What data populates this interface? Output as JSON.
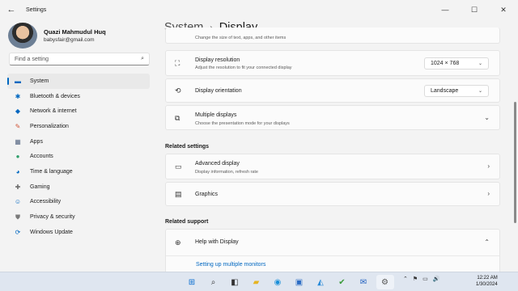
{
  "window": {
    "title": "Settings",
    "back_icon": "back-arrow-icon",
    "controls": {
      "minimize": "—",
      "maximize": "☐",
      "close": "✕"
    }
  },
  "profile": {
    "name": "Quazi Mahmudul Huq",
    "email": "babysfair@gmail.com"
  },
  "search": {
    "placeholder": "Find a setting",
    "icon": "search-icon"
  },
  "sidebar": {
    "items": [
      {
        "label": "System",
        "icon": "display-icon",
        "glyph": "▬",
        "color": "#0067c0",
        "active": true
      },
      {
        "label": "Bluetooth & devices",
        "icon": "bluetooth-icon",
        "glyph": "✱",
        "color": "#0067c0",
        "active": false
      },
      {
        "label": "Network & internet",
        "icon": "wifi-icon",
        "glyph": "◆",
        "color": "#0067c0",
        "active": false
      },
      {
        "label": "Personalization",
        "icon": "brush-icon",
        "glyph": "✎",
        "color": "#d0563a",
        "active": false
      },
      {
        "label": "Apps",
        "icon": "apps-icon",
        "glyph": "▦",
        "color": "#5a6a86",
        "active": false
      },
      {
        "label": "Accounts",
        "icon": "person-icon",
        "glyph": "●",
        "color": "#2e9e6a",
        "active": false
      },
      {
        "label": "Time & language",
        "icon": "globe-clock-icon",
        "glyph": "◕",
        "color": "#0067c0",
        "active": false
      },
      {
        "label": "Gaming",
        "icon": "gamepad-icon",
        "glyph": "✚",
        "color": "#6b6b6b",
        "active": false
      },
      {
        "label": "Accessibility",
        "icon": "accessibility-icon",
        "glyph": "☺",
        "color": "#0067c0",
        "active": false
      },
      {
        "label": "Privacy & security",
        "icon": "shield-icon",
        "glyph": "⛊",
        "color": "#7a7a7a",
        "active": false
      },
      {
        "label": "Windows Update",
        "icon": "update-icon",
        "glyph": "⟳",
        "color": "#0067c0",
        "active": false
      }
    ]
  },
  "breadcrumb": {
    "parent": "System",
    "separator": "›",
    "current": "Display"
  },
  "cards": {
    "partial_sub": "Change the size of text, apps, and other items",
    "resolution": {
      "title": "Display resolution",
      "sub": "Adjust the resolution to fit your connected display",
      "value": "1024 × 768",
      "icon": "resolution-icon"
    },
    "orientation": {
      "title": "Display orientation",
      "value": "Landscape",
      "icon": "orientation-icon"
    },
    "multiple": {
      "title": "Multiple displays",
      "sub": "Choose the presentation mode for your displays",
      "icon": "multiple-displays-icon"
    }
  },
  "related_settings": {
    "heading": "Related settings",
    "advanced": {
      "title": "Advanced display",
      "sub": "Display information, refresh rate",
      "icon": "monitor-icon"
    },
    "graphics": {
      "title": "Graphics",
      "icon": "graphics-icon"
    }
  },
  "related_support": {
    "heading": "Related support",
    "help": {
      "title": "Help with Display",
      "icon": "help-globe-icon"
    },
    "link": "Setting up multiple monitors"
  },
  "taskbar": {
    "icons": [
      {
        "name": "start-icon",
        "glyph": "⊞",
        "color": "#0a6fd1"
      },
      {
        "name": "search-taskbar-icon",
        "glyph": "⌕",
        "color": "#333333"
      },
      {
        "name": "task-view-icon",
        "glyph": "◧",
        "color": "#333333"
      },
      {
        "name": "file-explorer-icon",
        "glyph": "▰",
        "color": "#e6b422"
      },
      {
        "name": "edge-icon",
        "glyph": "◉",
        "color": "#1a8fd9"
      },
      {
        "name": "store-icon",
        "glyph": "▣",
        "color": "#2b6cc4"
      },
      {
        "name": "photos-icon",
        "glyph": "◭",
        "color": "#2a8bd8"
      },
      {
        "name": "app-icon",
        "glyph": "✔",
        "color": "#3a9b3a"
      },
      {
        "name": "mail-icon",
        "glyph": "✉",
        "color": "#1f5fbf"
      },
      {
        "name": "settings-taskbar-icon",
        "glyph": "⚙",
        "color": "#555555"
      }
    ],
    "tray": [
      "⌃",
      "⚑",
      "▭",
      "🔊"
    ],
    "time": "12:22 AM",
    "date": "1/30/2024"
  }
}
